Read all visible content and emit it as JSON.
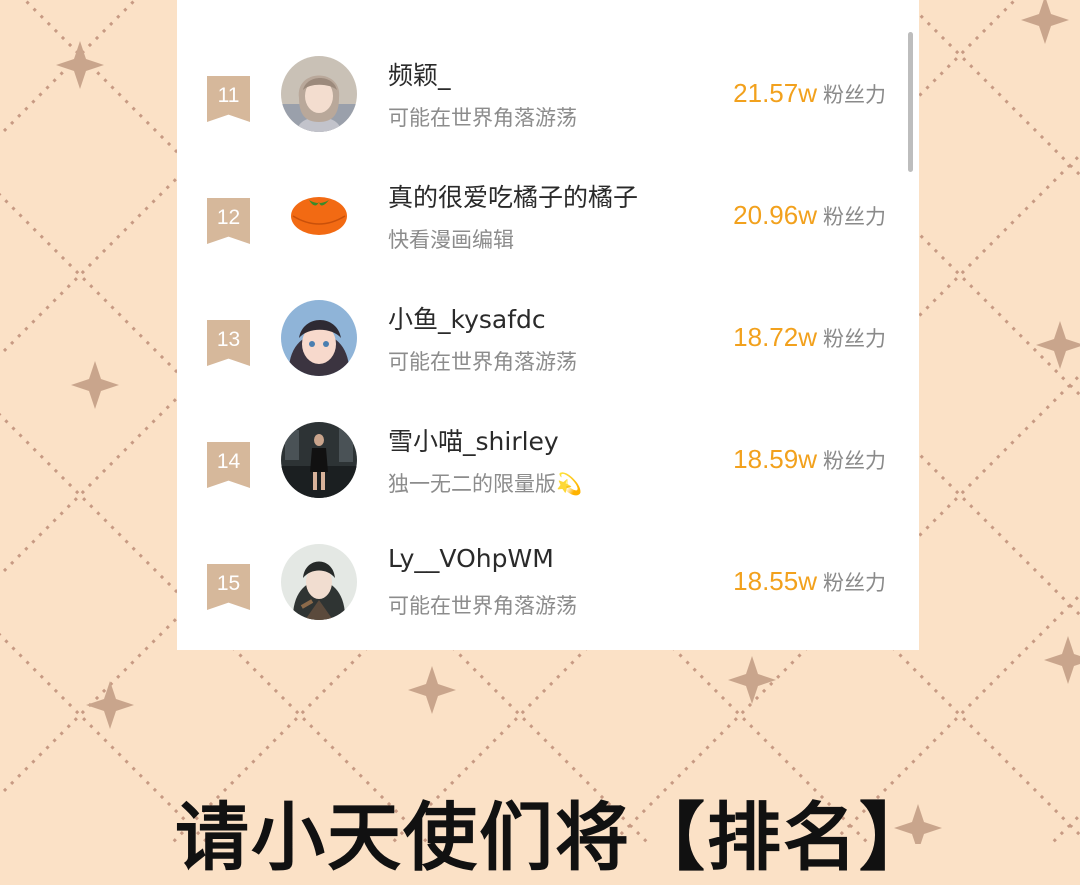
{
  "colors": {
    "background": "#fbe1c6",
    "rank_badge": "#d6b89b",
    "fans_value": "#f2a11d",
    "star": "#c9a58c"
  },
  "ranking": [
    {
      "rank": "11",
      "name": "频颖_",
      "subtitle": "可能在世界角落游荡",
      "fans": "21.57w",
      "fans_unit": "粉丝力",
      "avatar": "anime-girl-avatar"
    },
    {
      "rank": "12",
      "name": "真的很爱吃橘子的橘子",
      "subtitle": "快看漫画编辑",
      "fans": "20.96w",
      "fans_unit": "粉丝力",
      "avatar": "orange-avatar"
    },
    {
      "rank": "13",
      "name": "小鱼_kysafdc",
      "subtitle": "可能在世界角落游荡",
      "fans": "18.72w",
      "fans_unit": "粉丝力",
      "avatar": "anime-girl-blue-avatar"
    },
    {
      "rank": "14",
      "name": "雪小喵_shirley",
      "subtitle": "独一无二的限量版💫",
      "fans": "18.59w",
      "fans_unit": "粉丝力",
      "avatar": "photo-woman-avatar"
    },
    {
      "rank": "15",
      "name": "Ly__VOhpWM",
      "subtitle": "可能在世界角落游荡",
      "fans": "18.55w",
      "fans_unit": "粉丝力",
      "avatar": "anime-man-avatar"
    }
  ],
  "caption": "请小天使们将【排名】"
}
